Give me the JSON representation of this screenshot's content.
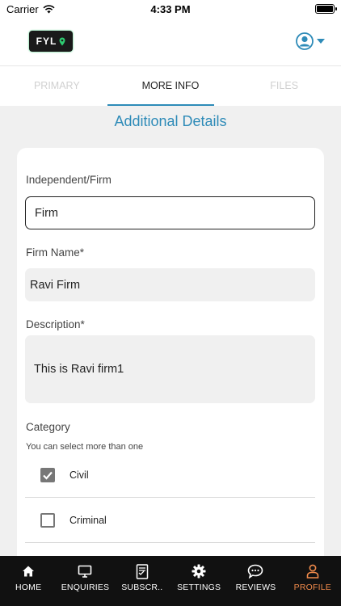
{
  "status_bar": {
    "carrier": "Carrier",
    "time": "4:33 PM"
  },
  "header": {
    "logo_text": "FYL",
    "accent_color": "#2e8bb8"
  },
  "tabs": [
    {
      "label": "PRIMARY",
      "active": false
    },
    {
      "label": "MORE INFO",
      "active": true
    },
    {
      "label": "FILES",
      "active": false
    }
  ],
  "section_title": "Additional Details",
  "form": {
    "independent_label": "Independent/Firm",
    "independent_value": "Firm",
    "firm_name_label": "Firm Name*",
    "firm_name_value": "Ravi Firm",
    "description_label": "Description*",
    "description_value": "This is Ravi firm1",
    "category_label": "Category",
    "category_hint": "You can select more than one",
    "categories": [
      {
        "label": "Civil",
        "checked": true
      },
      {
        "label": "Criminal",
        "checked": false
      }
    ]
  },
  "bottom_nav": [
    {
      "label": "HOME",
      "icon": "home-icon",
      "active": false
    },
    {
      "label": "ENQUIRIES",
      "icon": "monitor-icon",
      "active": false
    },
    {
      "label": "SUBSCR..",
      "icon": "document-icon",
      "active": false
    },
    {
      "label": "SETTINGS",
      "icon": "gear-icon",
      "active": false
    },
    {
      "label": "REVIEWS",
      "icon": "chat-bubble-icon",
      "active": false
    },
    {
      "label": "PROFILE",
      "icon": "person-icon",
      "active": true
    }
  ],
  "colors": {
    "accent": "#2e8bb8",
    "nav_active": "#f08a4b",
    "nav_bg": "#111111"
  }
}
